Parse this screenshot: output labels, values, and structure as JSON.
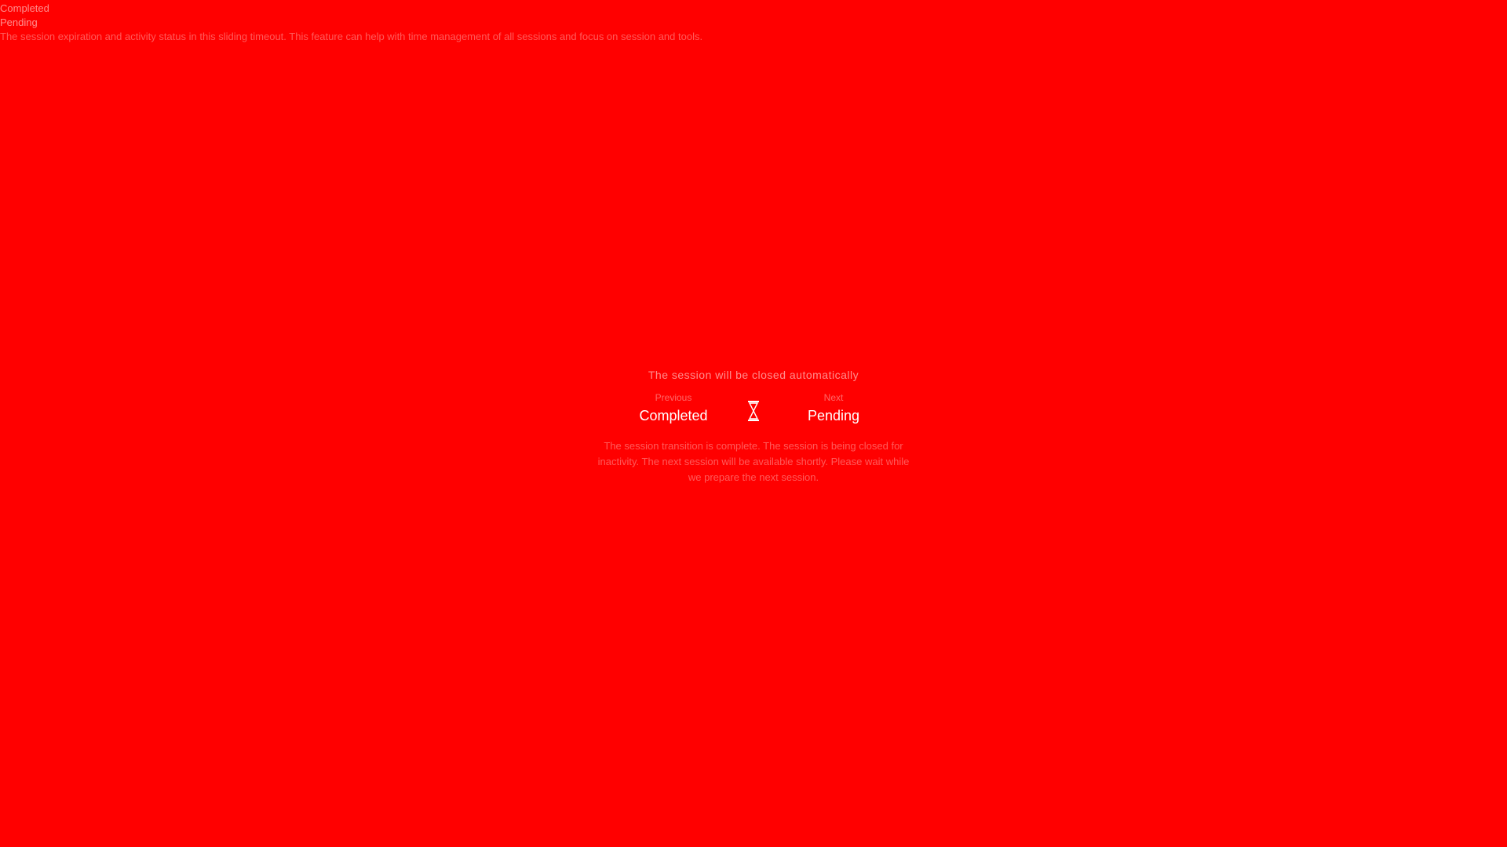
{
  "background_color": "#ff0000",
  "top_lines": [
    "",
    "",
    "Completed",
    "",
    "",
    "Pending",
    "The session expiration and activity status in this sliding timeout. This feature can help with time management of all sessions and focus on session and tools."
  ],
  "corner_mark": "",
  "panel": {
    "title": "The session will be closed automatically",
    "previous_label": "Previous",
    "previous_status": "Completed",
    "next_label": "Next",
    "next_status": "Pending",
    "hourglass_icon": "hourglass-icon",
    "description": "The session transition is complete. The session is being closed for inactivity. The next session will be available shortly. Please wait while we prepare the next session."
  }
}
